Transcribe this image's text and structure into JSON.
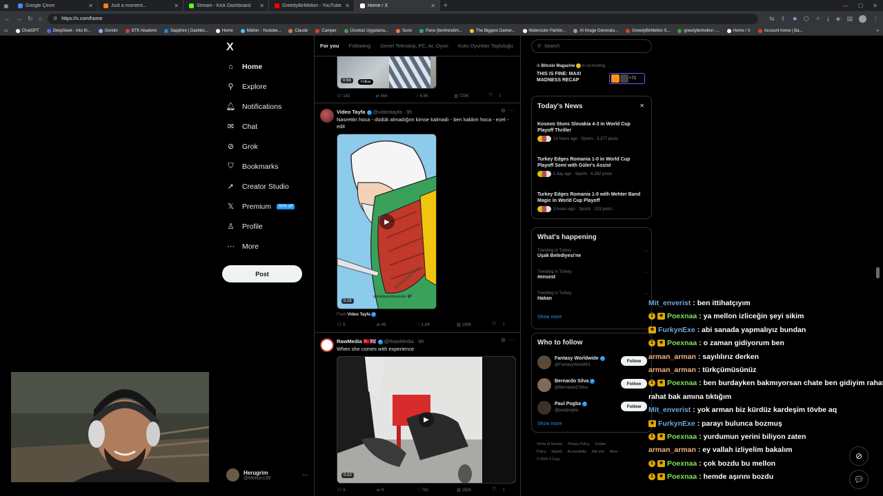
{
  "browser": {
    "tabs": [
      {
        "label": "Google Çeviri",
        "color": "#4285f4",
        "active": false
      },
      {
        "label": "Just a moment...",
        "color": "#f38020",
        "active": false
      },
      {
        "label": "Stream - Kick Dashboard",
        "color": "#53fc18",
        "active": false
      },
      {
        "label": "GreedyBirMellon - YouTube",
        "color": "#ff0000",
        "active": false
      },
      {
        "label": "Home / X",
        "color": "#ffffff",
        "active": true
      }
    ],
    "url": "https://x.com/home",
    "bookmarks": [
      {
        "label": "ChatGPT",
        "color": "#ffffff"
      },
      {
        "label": "DeepSeek - Into th...",
        "color": "#4d6bfe"
      },
      {
        "label": "Gemini",
        "color": "#8ab4f8"
      },
      {
        "label": "BTK Akademi",
        "color": "#e53935"
      },
      {
        "label": "Sapphire | Dashbo...",
        "color": "#1e88e5"
      },
      {
        "label": "Home",
        "color": "#ffffff"
      },
      {
        "label": "Mellon - Youtube...",
        "color": "#4fc3f7"
      },
      {
        "label": "Claude",
        "color": "#d97757"
      },
      {
        "label": "Camper",
        "color": "#e53935"
      },
      {
        "label": "Ücretsiz Uygulama...",
        "color": "#43a047"
      },
      {
        "label": "Suno",
        "color": "#ff7043"
      },
      {
        "label": "Pano (bentrendim...",
        "color": "#26a69a"
      },
      {
        "label": "The Biggest Gamer...",
        "color": "#fbc02d"
      },
      {
        "label": "Watercolor Paintin...",
        "color": "#ffffff"
      },
      {
        "label": "AI Image Generato...",
        "color": "#9e9e9e"
      },
      {
        "label": "GreedyBirMellon S...",
        "color": "#e53935"
      },
      {
        "label": "greedybirmellon -...",
        "color": "#43a047"
      },
      {
        "label": "Home / X",
        "color": "#ffffff"
      },
      {
        "label": "Account home | Ba...",
        "color": "#e53935"
      }
    ]
  },
  "nav": {
    "logo": "X",
    "items": [
      {
        "label": "Home",
        "icon": "home-icon",
        "glyph": "⌂"
      },
      {
        "label": "Explore",
        "icon": "search-icon",
        "glyph": "⚲"
      },
      {
        "label": "Notifications",
        "icon": "bell-icon",
        "glyph": "🔔︎"
      },
      {
        "label": "Chat",
        "icon": "envelope-icon",
        "glyph": "✉"
      },
      {
        "label": "Grok",
        "icon": "grok-icon",
        "glyph": "⊘"
      },
      {
        "label": "Bookmarks",
        "icon": "bookmark-icon",
        "glyph": "⛉"
      },
      {
        "label": "Creator Studio",
        "icon": "rocket-icon",
        "glyph": "➚"
      },
      {
        "label": "Premium",
        "icon": "x-logo-icon",
        "glyph": "𝕏"
      },
      {
        "label": "Profile",
        "icon": "person-icon",
        "glyph": "♙"
      },
      {
        "label": "More",
        "icon": "more-circle-icon",
        "glyph": "⋯"
      }
    ],
    "premium_badge": "50% off",
    "post_label": "Post",
    "account": {
      "name": "Herugrim",
      "handle": "@Mellon199"
    }
  },
  "feed": {
    "tabs": [
      "For you",
      "Following",
      "Genel Teknoloji, PC, AI, Oyun",
      "Kutu Oyunları Topluluğu"
    ],
    "top": {
      "duration": "0:54",
      "follow": "Follow",
      "replies": "142",
      "reposts": "464",
      "likes": "6.9K",
      "views": "725K"
    },
    "tweet1": {
      "name": "Video Tayfa",
      "handle": "@videotayfa",
      "time": "· 9h",
      "text": "Nasrettin hoca - düdük almadığım kimse kalmadı - ben kaldım hoca - ezel - edit",
      "duration": "0:15",
      "watermark1": "@ottomanarts.comics",
      "watermark2": "dahaliseninbasinda 🖤",
      "from_label": "From",
      "from_name": "Video Tayfa",
      "replies": "5",
      "reposts": "49",
      "likes": "1.6K",
      "views": "106K"
    },
    "tweet2": {
      "name": "RawMedia",
      "flags": "🇹🇷🇬🇧",
      "handle": "@RawMedia",
      "time": "· 6h",
      "text": "When she comes with experience",
      "duration": "0:10",
      "replies": "9",
      "reposts": "9",
      "likes": "742",
      "views": "150K"
    }
  },
  "right": {
    "search_placeholder": "Search",
    "live": {
      "host": "Bitcoin Magazine",
      "suffix": "is co-hosting",
      "title": "THIS IS FINE: MAXI MADNESS RECAP",
      "count": "+71"
    },
    "news": {
      "title": "Today's News",
      "items": [
        {
          "headline": "Kosovo Stuns Slovakia 4-3 in World Cup Playoff Thriller",
          "meta": "14 hours ago · Sports · 3,377 posts"
        },
        {
          "headline": "Turkey Edges Romania 1-0 in World Cup Playoff Semi with Güler's Assist",
          "meta": "1 day ago · Sports · 6,392 posts"
        },
        {
          "headline": "Turkey Edges Romania 1-0 with Mehter Band Magic in World Cup Playoff",
          "meta": "3 hours ago · Sports · 233 posts"
        }
      ]
    },
    "happening": {
      "title": "What's happening",
      "items": [
        {
          "context": "Trending in Turkey",
          "topic": "Uşak Belediyesi'ne"
        },
        {
          "context": "Trending in Turkey",
          "topic": "#ensest"
        },
        {
          "context": "Trending in Turkey",
          "topic": "Hakan"
        }
      ],
      "show_more": "Show more"
    },
    "follow": {
      "title": "Who to follow",
      "items": [
        {
          "name": "Fantasy Worldwide",
          "handle": "@FantasyWorldW1",
          "button": "Follow"
        },
        {
          "name": "Bernardo Silva",
          "handle": "@BernardoCSilva",
          "button": "Follow"
        },
        {
          "name": "Paul Pogba",
          "handle": "@paulpogba",
          "button": "Follow"
        }
      ],
      "show_more": "Show more"
    },
    "footer": {
      "links": [
        "Terms of Service",
        "Privacy Policy",
        "Cookie Policy",
        "Imprint",
        "Accessibility",
        "Ads info",
        "More ···"
      ],
      "copyright": "© 2026 X Corp."
    }
  },
  "chat": {
    "messages": [
      {
        "badges": 0,
        "user": "Mit_enverist",
        "color": "#6fa8dc",
        "text": ": ben ittihatçıyım"
      },
      {
        "badges": 2,
        "user": "Poexnaa",
        "color": "#7fe35b",
        "text": ": ya mellon izliceğin şeyi sikim"
      },
      {
        "badges": 1,
        "user": "FurkynExe",
        "color": "#6fa8dc",
        "text": ": abi sanada yapmalıyız bundan"
      },
      {
        "badges": 2,
        "user": "Poexnaa",
        "color": "#7fe35b",
        "text": ": o zaman gidiyorum ben"
      },
      {
        "badges": 0,
        "user": "arman_arman",
        "color": "#f4b183",
        "text": ": sayılılırız derken"
      },
      {
        "badges": 0,
        "user": "arman_arman",
        "color": "#f4b183",
        "text": ": türkçümüsünüz"
      },
      {
        "badges": 2,
        "user": "Poexnaa",
        "color": "#7fe35b",
        "text": ": ben burdayken bakmıyorsan chate ben gidiyim rahat"
      },
      {
        "badges": 0,
        "user": "",
        "color": "#ffffff",
        "text": "rahat bak amına tıktığım"
      },
      {
        "badges": 0,
        "user": "Mit_enverist",
        "color": "#6fa8dc",
        "text": ": yok arman biz kürdüz kardeşim tövbe aq"
      },
      {
        "badges": 1,
        "user": "FurkynExe",
        "color": "#6fa8dc",
        "text": ": parayı bulunca bozmuş"
      },
      {
        "badges": 2,
        "user": "Poexnaa",
        "color": "#7fe35b",
        "text": ": yurdumun yerini biliyon zaten"
      },
      {
        "badges": 0,
        "user": "arman_arman",
        "color": "#f4b183",
        "text": ": ey vallah izliyelim bakalım"
      },
      {
        "badges": 2,
        "user": "Poexnaa",
        "color": "#7fe35b",
        "text": ": çok bozdu bu mellon"
      },
      {
        "badges": 2,
        "user": "Poexnaa",
        "color": "#7fe35b",
        "text": ": hemde aşırını bozdu"
      }
    ]
  },
  "colors": {
    "accent": "#1d9bf0",
    "background": "#000000",
    "border": "#2f3336",
    "muted": "#71767b"
  }
}
